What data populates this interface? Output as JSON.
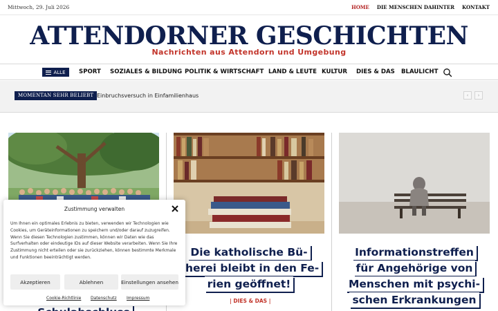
{
  "topbar": {
    "date": "Mittwoch, 29. Juli 2026",
    "links": [
      "HOME",
      "DIE MENSCHEN DAHINTER",
      "KONTAKT"
    ],
    "active_link": "HOME"
  },
  "masthead": {
    "title": "ATTENDORNER GESCHICHTEN",
    "subtitle": "Nachrichten aus Attendorn und Umgebung"
  },
  "nav": {
    "all_label": "ALLE",
    "items": [
      "SPORT",
      "SOZIALES & BILDUNG",
      "POLITIK & WIRTSCHAFT",
      "LAND & LEUTE",
      "KULTUR",
      "DIES & DAS",
      "BLAULICHT"
    ],
    "search_icon": "search-icon"
  },
  "trending": {
    "label": "MOMENTAN SEHR BELIEBT",
    "headline": "Einbruchsversuch in Einfamilienhaus",
    "prev_icon": "chevron-left-icon",
    "next_icon": "chevron-right-icon"
  },
  "articles": [
    {
      "image_desc_icon": "group-photo-icon",
      "headline_lines": [
        "Schulabschluss"
      ]
    },
    {
      "image_desc_icon": "books-photo-icon",
      "headline_lines": [
        "Die katholische Bü-",
        "cherei bleibt in den Fe-",
        "rien geöffnet!"
      ],
      "category": "| DIES & DAS |"
    },
    {
      "image_desc_icon": "bench-photo-icon",
      "headline_lines": [
        "Informationstreffen",
        "für Angehörige von",
        "Menschen mit psychi-",
        "schen Erkrankungen"
      ]
    }
  ],
  "cookie": {
    "title": "Zustimmung verwalten",
    "body": "Um Ihnen ein optimales Erlebnis zu bieten, verwenden wir Technologien wie Cookies, um Geräteinformationen zu speichern und/oder darauf zuzugreifen. Wenn Sie diesen Technologien zustimmen, können wir Daten wie das Surfverhalten oder eindeutige IDs auf dieser Website verarbeiten. Wenn Sie Ihre Zustimmung nicht erteilen oder sie zurückziehen, können bestimmte Merkmale und Funktionen beeinträchtigt werden.",
    "accept": "Akzeptieren",
    "decline": "Ablehnen",
    "settings": "Einstellungen ansehen",
    "links": [
      "Cookie-Richtlinie",
      "Datenschutz",
      "Impressum"
    ]
  },
  "colors": {
    "navy": "#0f1f4e",
    "accent_red": "#c2342a",
    "active_link": "#b21f1f"
  }
}
